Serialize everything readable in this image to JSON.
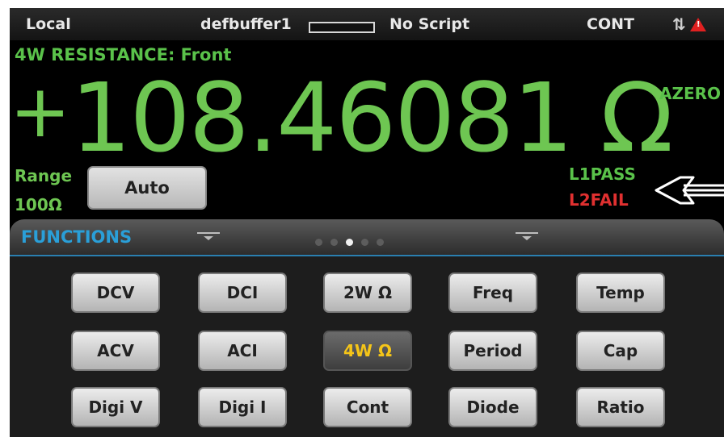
{
  "status_bar": {
    "mode": "Local",
    "buffer": "defbuffer1",
    "script": "No Script",
    "trigger": "CONT"
  },
  "measurement": {
    "function_title": "4W RESISTANCE: Front",
    "sign": "+",
    "value": "108.46081 Ω",
    "azero": "AZERO",
    "range_label": "Range",
    "range_value": "100Ω",
    "auto_button": "Auto",
    "limit1": "L1PASS",
    "limit2": "L2FAIL"
  },
  "panel": {
    "title": "FUNCTIONS",
    "page_count": 5,
    "active_page": 3
  },
  "functions": [
    [
      "DCV",
      "DCI",
      "2W Ω",
      "Freq",
      "Temp"
    ],
    [
      "ACV",
      "ACI",
      "4W Ω",
      "Period",
      "Cap"
    ],
    [
      "Digi V",
      "Digi I",
      "Cont",
      "Diode",
      "Ratio"
    ]
  ],
  "selected_function": "4W Ω",
  "colors": {
    "reading": "#6ec652",
    "pass": "#5ac24a",
    "fail": "#e03030",
    "panel_title": "#2a9fd8",
    "selected_text": "#f5c518",
    "warning": "#e02020"
  },
  "icons": [
    "continuous-trigger-icon",
    "warning-icon",
    "swipe-handle-icon",
    "page-dot-icon",
    "pointer-arrow-icon"
  ]
}
